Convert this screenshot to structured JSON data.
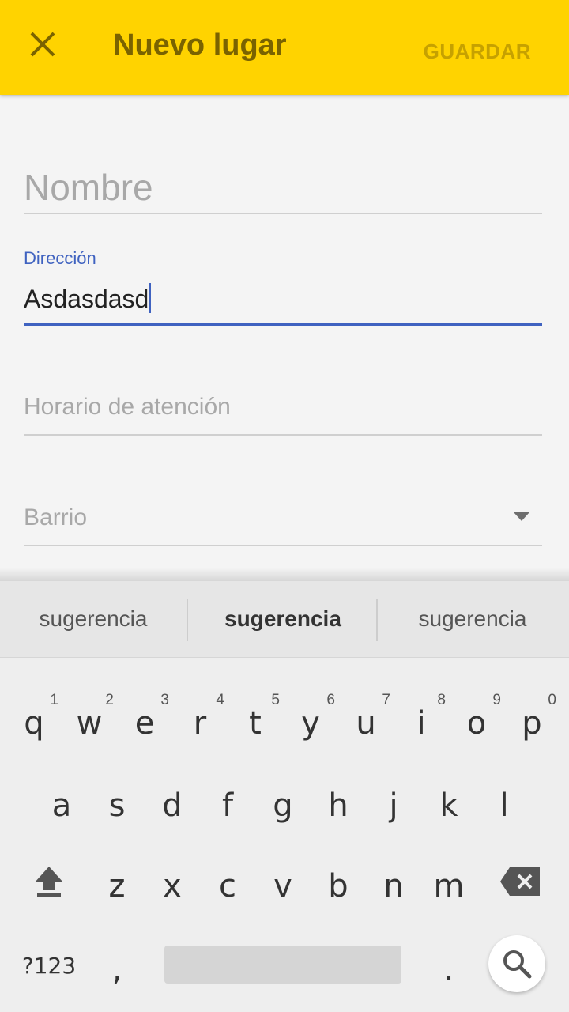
{
  "appbar": {
    "title": "Nuevo lugar",
    "save_label": "GUARDAR",
    "color": "#ffd300",
    "close_icon": "close-icon"
  },
  "form": {
    "nombre": {
      "placeholder": "Nombre"
    },
    "direccion": {
      "label": "Dirección",
      "value": "Asdasdasd"
    },
    "horario": {
      "placeholder": "Horario de atención"
    },
    "barrio": {
      "placeholder": "Barrio"
    },
    "accent_color": "#3f62c0"
  },
  "keyboard": {
    "suggestions": [
      "sugerencia",
      "sugerencia",
      "sugerencia"
    ],
    "row1": [
      {
        "key": "q",
        "hint": "1"
      },
      {
        "key": "w",
        "hint": "2"
      },
      {
        "key": "e",
        "hint": "3"
      },
      {
        "key": "r",
        "hint": "4"
      },
      {
        "key": "t",
        "hint": "5"
      },
      {
        "key": "y",
        "hint": "6"
      },
      {
        "key": "u",
        "hint": "7"
      },
      {
        "key": "i",
        "hint": "8"
      },
      {
        "key": "o",
        "hint": "9"
      },
      {
        "key": "p",
        "hint": "0"
      }
    ],
    "row2": [
      "a",
      "s",
      "d",
      "f",
      "g",
      "h",
      "j",
      "k",
      "l"
    ],
    "row3": [
      "z",
      "x",
      "c",
      "v",
      "b",
      "n",
      "m"
    ],
    "symbols_label": "?123",
    "comma": ",",
    "period": ".",
    "icons": {
      "shift": "shift-icon",
      "backspace": "backspace-icon",
      "search": "search-icon"
    }
  }
}
